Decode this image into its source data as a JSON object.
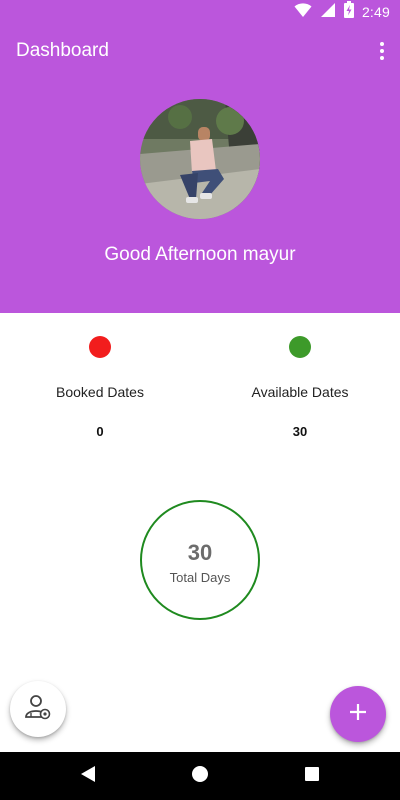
{
  "status_bar": {
    "time": "2:49",
    "icons": [
      "wifi-icon",
      "signal-icon",
      "battery-charging-icon"
    ]
  },
  "app_bar": {
    "title": "Dashboard",
    "menu_icon": "more-vert-icon"
  },
  "profile": {
    "greeting": "Good Afternoon mayur"
  },
  "stats": {
    "booked": {
      "label": "Booked Dates",
      "value": "0",
      "color": "#f21d1d"
    },
    "available": {
      "label": "Available Dates",
      "value": "30",
      "color": "#3d9a2a"
    }
  },
  "total": {
    "value": "30",
    "label": "Total Days",
    "ring_color": "#1f8a1f"
  },
  "fabs": {
    "profile_icon": "user-settings-icon",
    "add_icon": "plus-icon"
  },
  "nav": {
    "back_icon": "back-icon",
    "home_icon": "home-icon",
    "recents_icon": "recents-icon"
  },
  "colors": {
    "accent": "#bb56dc"
  }
}
